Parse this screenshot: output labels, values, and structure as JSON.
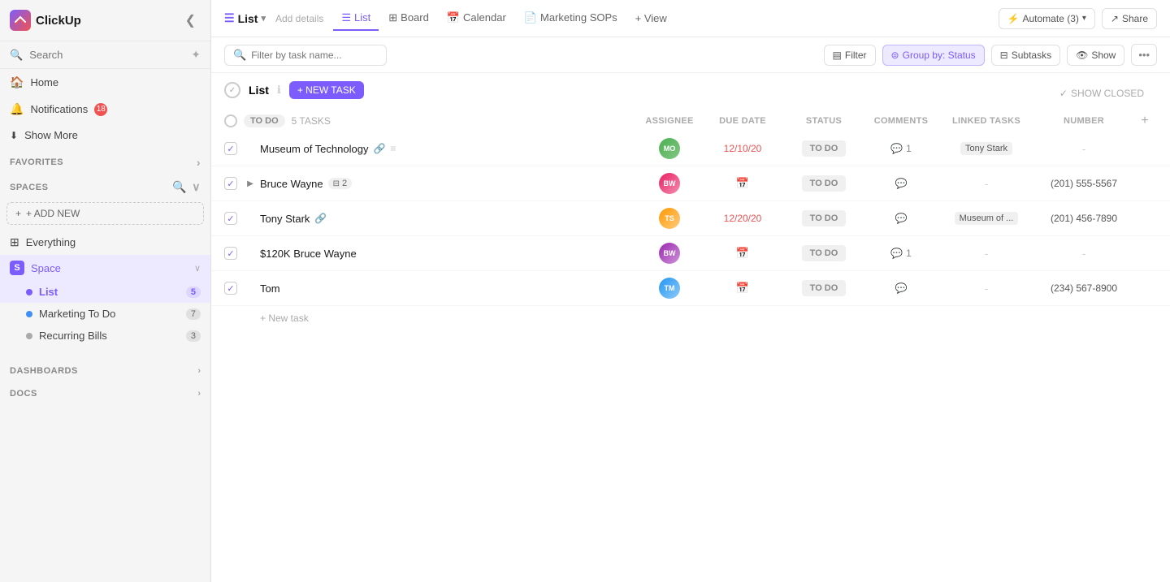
{
  "app": {
    "name": "ClickUp",
    "logo_text": "CU"
  },
  "sidebar": {
    "search_placeholder": "Search",
    "nav_items": [
      {
        "id": "home",
        "label": "Home",
        "icon": "🏠"
      },
      {
        "id": "notifications",
        "label": "Notifications",
        "icon": "🔔",
        "badge": "18"
      },
      {
        "id": "show-more",
        "label": "Show More",
        "icon": "⬇"
      }
    ],
    "favorites_label": "FAVORITES",
    "spaces_label": "SPACES",
    "add_new_label": "+ ADD NEW",
    "everything_label": "Everything",
    "space_name": "Space",
    "list_label": "List",
    "list_count": "5",
    "marketing_todo_label": "Marketing To Do",
    "marketing_todo_count": "7",
    "recurring_bills_label": "Recurring Bills",
    "recurring_bills_count": "3",
    "dashboards_label": "DASHBOARDS",
    "docs_label": "DOCS"
  },
  "header": {
    "list_title": "List",
    "add_details": "Add details",
    "tabs": [
      {
        "id": "list",
        "label": "List",
        "icon": "☰",
        "active": true
      },
      {
        "id": "board",
        "label": "Board",
        "icon": "⊞"
      },
      {
        "id": "calendar",
        "label": "Calendar",
        "icon": "📅"
      },
      {
        "id": "marketing-sops",
        "label": "Marketing SOPs",
        "icon": "📄"
      }
    ],
    "add_view_label": "+ View",
    "automate_label": "Automate (3)",
    "share_label": "Share"
  },
  "toolbar": {
    "filter_placeholder": "Filter by task name...",
    "filter_label": "Filter",
    "group_by_label": "Group by: Status",
    "subtasks_label": "Subtasks",
    "show_label": "Show"
  },
  "task_list": {
    "group_name": "TO DO",
    "task_count": "5 TASKS",
    "new_task_label": "+ NEW TASK",
    "show_closed_label": "SHOW CLOSED",
    "new_task_inline_label": "+ New task",
    "columns": {
      "assignee": "ASSIGNEE",
      "due_date": "DUE DATE",
      "status": "STATUS",
      "comments": "COMMENTS",
      "linked_tasks": "LINKED TASKS",
      "number": "NUMBER"
    },
    "tasks": [
      {
        "id": "1",
        "name": "Museum of Technology",
        "has_link": true,
        "has_menu": true,
        "assignee_color": "#4caf50",
        "assignee_initials": "MO",
        "due_date": "12/10/20",
        "due_overdue": true,
        "status": "TO DO",
        "comment_count": "1",
        "linked_task": "Tony Stark",
        "number": "-"
      },
      {
        "id": "2",
        "name": "Bruce Wayne",
        "subtask_count": "2",
        "has_expand": true,
        "assignee_color": "#e91e63",
        "assignee_initials": "BW",
        "due_date": "",
        "status": "TO DO",
        "comment_count": "",
        "linked_task": "-",
        "number": "(201) 555-5567"
      },
      {
        "id": "3",
        "name": "Tony Stark",
        "has_link": true,
        "assignee_color": "#ff9800",
        "assignee_initials": "TS",
        "due_date": "12/20/20",
        "due_overdue": true,
        "status": "TO DO",
        "comment_count": "",
        "linked_task": "Museum of ...",
        "number": "(201) 456-7890"
      },
      {
        "id": "4",
        "name": "$120K Bruce Wayne",
        "assignee_color": "#9c27b0",
        "assignee_initials": "BW",
        "due_date": "",
        "status": "TO DO",
        "comment_count": "1",
        "linked_task": "-",
        "number": "-"
      },
      {
        "id": "5",
        "name": "Tom",
        "assignee_color": "#2196f3",
        "assignee_initials": "TM",
        "due_date": "",
        "status": "TO DO",
        "comment_count": "",
        "linked_task": "-",
        "number": "(234) 567-8900"
      }
    ]
  }
}
